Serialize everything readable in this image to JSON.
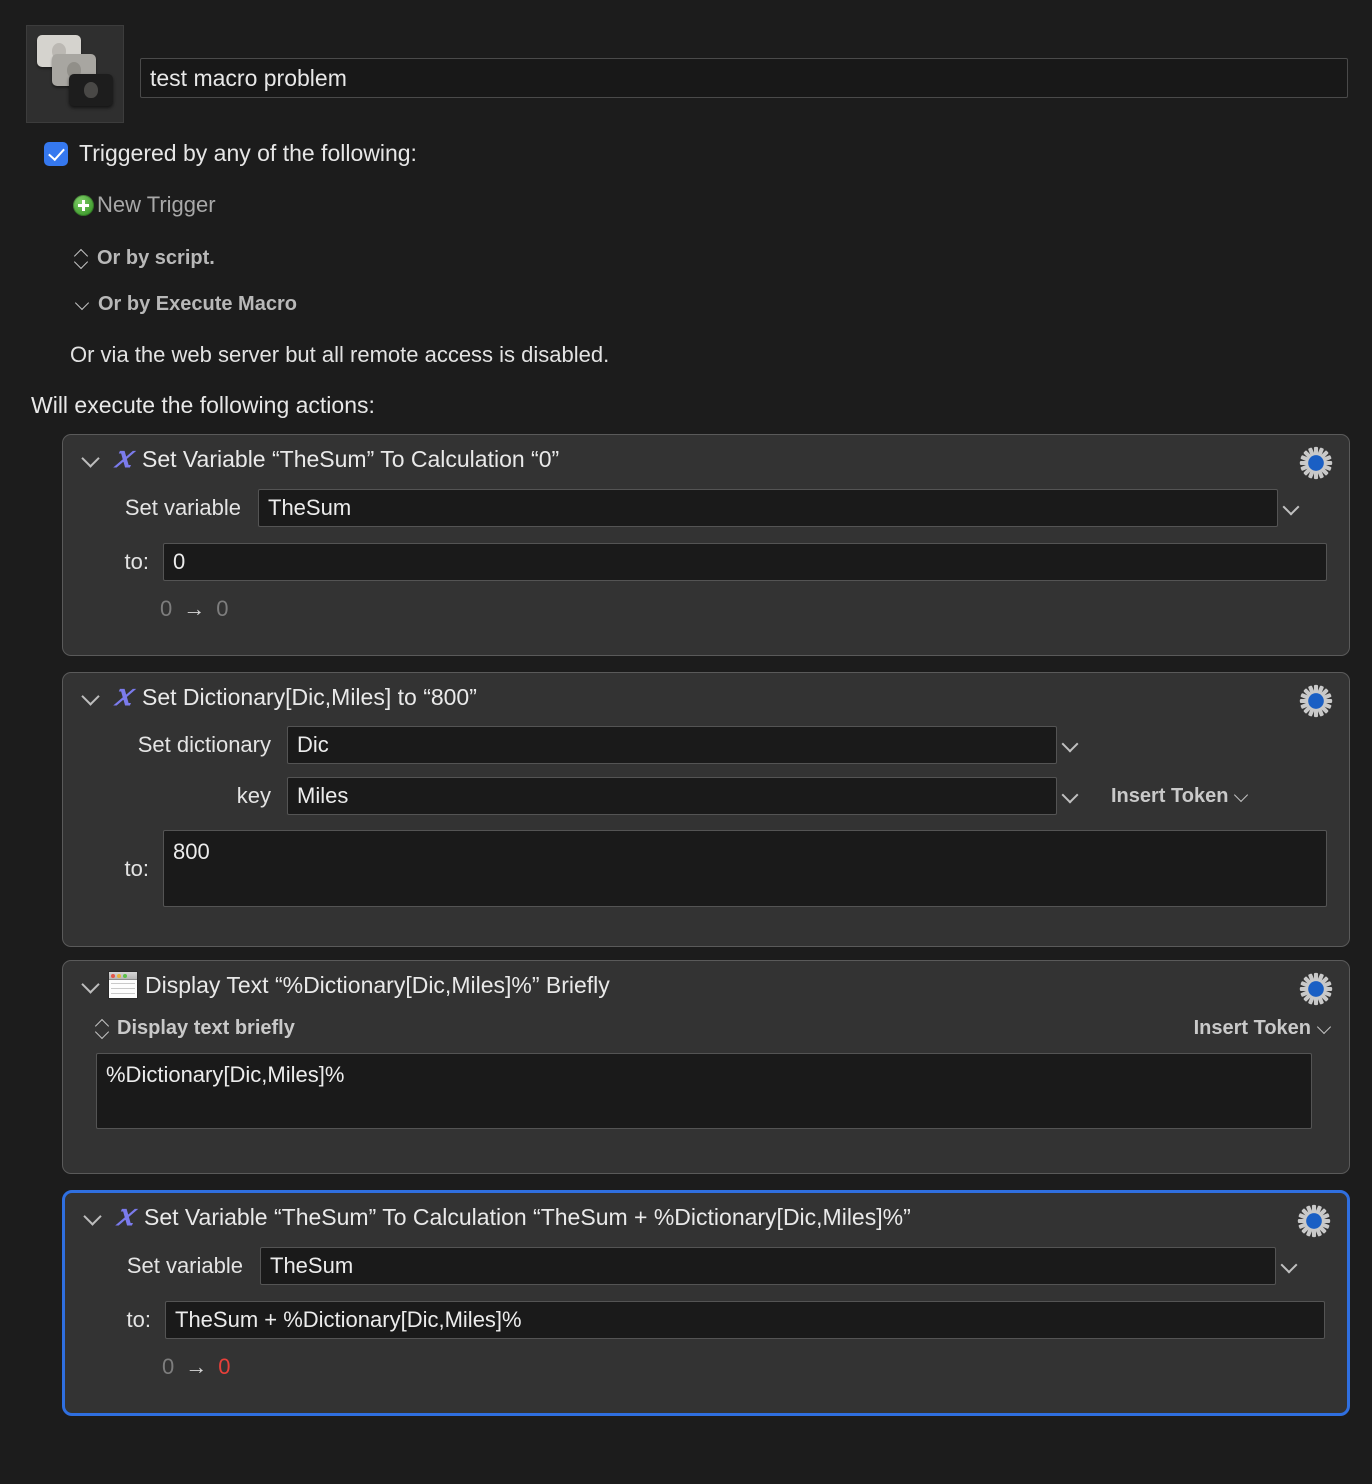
{
  "header": {
    "macro_icon": "macro-keycaps-icon",
    "title_value": "test macro problem"
  },
  "triggers": {
    "checkbox_checked": true,
    "label": "Triggered by any of the following:",
    "new_trigger_label": "New Trigger",
    "or_by_script": "Or by script.",
    "or_by_execute_macro": "Or by Execute Macro",
    "web_server_note": "Or via the web server but all remote access is disabled."
  },
  "actions_intro": "Will execute the following actions:",
  "insert_token_label": "Insert Token",
  "colors": {
    "accent_blue": "#3578ef",
    "selection_blue": "#2f6fe0",
    "gear_blue": "#1a5fc4",
    "x_icon_purple": "#7b7bec",
    "error_red": "#e8403a",
    "card_bg": "#333333",
    "page_bg": "#1c1c1c",
    "field_bg": "#1a1a1a"
  },
  "actions": [
    {
      "icon": "calculation-x-icon",
      "title": "Set Variable “TheSum” To Calculation “0”",
      "selected": false,
      "gear": "gear-icon",
      "fields": {
        "variable_label": "Set variable",
        "variable_value": "TheSum",
        "to_label": "to:",
        "to_value": "0"
      },
      "result": {
        "before": "0",
        "arrow": "→",
        "after": "0",
        "after_error": false
      }
    },
    {
      "icon": "calculation-x-icon",
      "title": "Set Dictionary[Dic,Miles] to “800”",
      "selected": false,
      "gear": "gear-icon",
      "fields": {
        "dictionary_label": "Set dictionary",
        "dictionary_value": "Dic",
        "key_label": "key",
        "key_value": "Miles",
        "to_label": "to:",
        "to_value": "800"
      }
    },
    {
      "icon": "display-window-icon",
      "title": "Display Text “%Dictionary[Dic,Miles]%” Briefly",
      "selected": false,
      "gear": "gear-icon",
      "fields": {
        "mode_label": "Display text briefly",
        "text_value": "%Dictionary[Dic,Miles]%"
      }
    },
    {
      "icon": "calculation-x-icon",
      "title": "Set Variable “TheSum” To Calculation “TheSum + %Dictionary[Dic,Miles]%”",
      "selected": true,
      "gear": "gear-icon",
      "fields": {
        "variable_label": "Set variable",
        "variable_value": "TheSum",
        "to_label": "to:",
        "to_value": "TheSum + %Dictionary[Dic,Miles]%"
      },
      "result": {
        "before": "0",
        "arrow": "→",
        "after": "0",
        "after_error": true
      }
    }
  ]
}
